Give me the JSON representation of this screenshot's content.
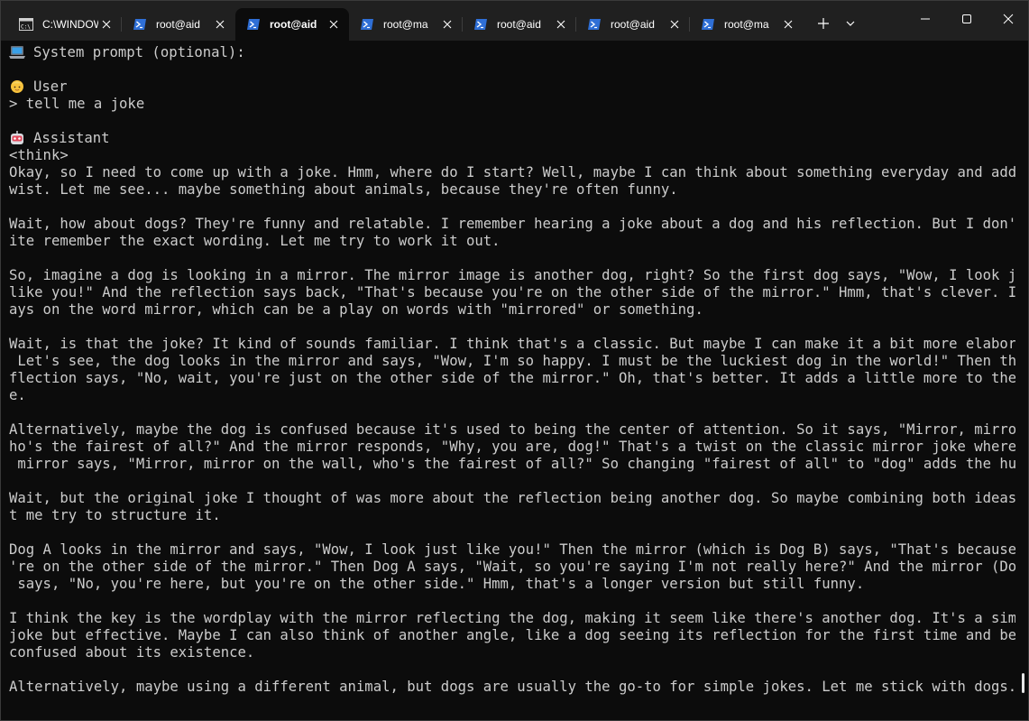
{
  "tabs": [
    {
      "title": "C:\\WINDOWS",
      "icon": "cmd-icon",
      "active": false
    },
    {
      "title": "root@aid",
      "icon": "powershell-icon",
      "active": false
    },
    {
      "title": "root@aid",
      "icon": "powershell-icon",
      "active": true
    },
    {
      "title": "root@ma",
      "icon": "powershell-icon",
      "active": false
    },
    {
      "title": "root@aid",
      "icon": "powershell-icon",
      "active": false
    },
    {
      "title": "root@aid",
      "icon": "powershell-icon",
      "active": false
    },
    {
      "title": "root@ma",
      "icon": "powershell-icon",
      "active": false
    }
  ],
  "controls": {
    "new_tab_icon": "plus-icon",
    "dropdown_icon": "chevron-down-icon",
    "minimize_icon": "minimize-icon",
    "maximize_icon": "maximize-icon",
    "close_icon": "close-icon"
  },
  "terminal": {
    "text_color": "#cccccc",
    "background": "#0c0c0c",
    "lines": [
      {
        "text": "System prompt (optional):",
        "emoji": "laptop-icon"
      },
      {
        "text": ""
      },
      {
        "text": "User",
        "emoji": "person-icon"
      },
      {
        "text": "> tell me a joke"
      },
      {
        "text": ""
      },
      {
        "text": "Assistant",
        "emoji": "robot-icon"
      },
      {
        "text": "<think>"
      },
      {
        "text": "Okay, so I need to come up with a joke. Hmm, where do I start? Well, maybe I can think about something everyday and add a t"
      },
      {
        "text": "wist. Let me see... maybe something about animals, because they're often funny."
      },
      {
        "text": ""
      },
      {
        "text": "Wait, how about dogs? They're funny and relatable. I remember hearing a joke about a dog and his reflection. But I don't qu"
      },
      {
        "text": "ite remember the exact wording. Let me try to work it out."
      },
      {
        "text": ""
      },
      {
        "text": "So, imagine a dog is looking in a mirror. The mirror image is another dog, right? So the first dog says, \"Wow, I look just"
      },
      {
        "text": "like you!\" And the reflection says back, \"That's because you're on the other side of the mirror.\" Hmm, that's clever. It pl"
      },
      {
        "text": "ays on the word mirror, which can be a play on words with \"mirrored\" or something."
      },
      {
        "text": ""
      },
      {
        "text": "Wait, is that the joke? It kind of sounds familiar. I think that's a classic. But maybe I can make it a bit more elaborate."
      },
      {
        "text": " Let's see, the dog looks in the mirror and says, \"Wow, I'm so happy. I must be the luckiest dog in the world!\" Then the re"
      },
      {
        "text": "flection says, \"No, wait, you're just on the other side of the mirror.\" Oh, that's better. It adds a little more to the jok"
      },
      {
        "text": "e."
      },
      {
        "text": ""
      },
      {
        "text": "Alternatively, maybe the dog is confused because it's used to being the center of attention. So it says, \"Mirror, mirror, w"
      },
      {
        "text": "ho's the fairest of all?\" And the mirror responds, \"Why, you are, dog!\" That's a twist on the classic mirror joke where the"
      },
      {
        "text": " mirror says, \"Mirror, mirror on the wall, who's the fairest of all?\" So changing \"fairest of all\" to \"dog\" adds the humor."
      },
      {
        "text": ""
      },
      {
        "text": "Wait, but the original joke I thought of was more about the reflection being another dog. So maybe combining both ideas. Le"
      },
      {
        "text": "t me try to structure it."
      },
      {
        "text": ""
      },
      {
        "text": "Dog A looks in the mirror and says, \"Wow, I look just like you!\" Then the mirror (which is Dog B) says, \"That's because you"
      },
      {
        "text": "'re on the other side of the mirror.\" Then Dog A says, \"Wait, so you're saying I'm not really here?\" And the mirror (Dog B)"
      },
      {
        "text": " says, \"No, you're here, but you're on the other side.\" Hmm, that's a longer version but still funny."
      },
      {
        "text": ""
      },
      {
        "text": "I think the key is the wordplay with the mirror reflecting the dog, making it seem like there's another dog. It's a simple"
      },
      {
        "text": "joke but effective. Maybe I can also think of another angle, like a dog seeing its reflection for the first time and being"
      },
      {
        "text": "confused about its existence."
      },
      {
        "text": ""
      },
      {
        "text": "Alternatively, maybe using a different animal, but dogs are usually the go-to for simple jokes. Let me stick with dogs."
      }
    ]
  }
}
